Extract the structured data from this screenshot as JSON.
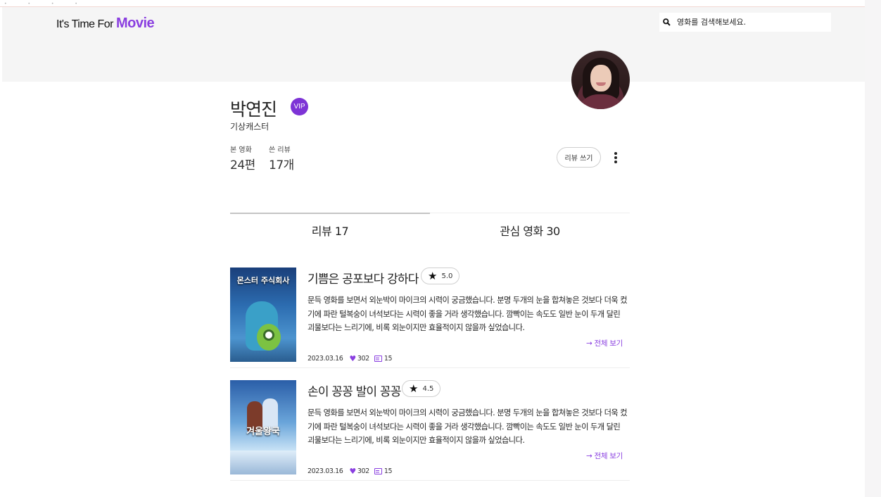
{
  "header": {
    "logo_prefix": "It's Time For ",
    "logo_accent": "Movie",
    "search_placeholder": "영화를 검색해보세요."
  },
  "profile": {
    "name": "박연진",
    "badge": "VIP",
    "job": "기상캐스터",
    "stats": [
      {
        "label": "본 영화",
        "value": "24편"
      },
      {
        "label": "쓴 리뷰",
        "value": "17개"
      }
    ],
    "write_review_label": "리뷰 쓰기"
  },
  "tabs": [
    {
      "label": "리뷰 17",
      "active": true
    },
    {
      "label": "관심 영화 30",
      "active": false
    }
  ],
  "reviews": [
    {
      "poster_text": "몬스터 주식회사",
      "title": "기쁨은 공포보다 강하다",
      "rating": "5.0",
      "body": "문득 영화를 보면서 외눈박이 마이크의 시력이 궁금했습니다. 분명 두개의 눈을 합쳐놓은 것보다 더욱 컸기에 파란 털복숭이 녀석보다는 시력이 좋을 거라 생각했습니다. 깜빡이는 속도도 일반 눈이 두개 달린 괴물보다는 느리기에, 비록 외눈이지만 효율적이지 않을까 싶었습니다.",
      "more_label": "→ 전체 보기",
      "date": "2023.03.16",
      "likes": "302",
      "comments": "15"
    },
    {
      "poster_text": "겨울왕국",
      "title": "손이 꽁꽁 발이 꽁꽁",
      "rating": "4.5",
      "body": "문득 영화를 보면서 외눈박이 마이크의 시력이 궁금했습니다. 분명 두개의 눈을 합쳐놓은 것보다 더욱 컸기에 파란 털복숭이 녀석보다는 시력이 좋을 거라 생각했습니다. 깜빡이는 속도도 일반 눈이 두개 달린 괴물보다는 느리기에, 비록 외눈이지만 효율적이지 않을까 싶었습니다.",
      "more_label": "→ 전체 보기",
      "date": "2023.03.16",
      "likes": "302",
      "comments": "15"
    }
  ],
  "colors": {
    "accent": "#8a3fe0",
    "header_bg": "#f5f5f5"
  }
}
